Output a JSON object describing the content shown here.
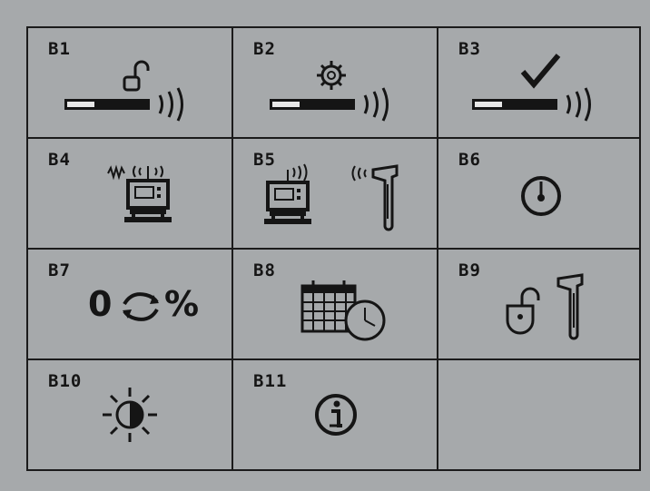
{
  "menu": {
    "cells": [
      {
        "label": "B1",
        "icon": "unlock-signal-strength-icon"
      },
      {
        "label": "B2",
        "icon": "gear-signal-strength-icon"
      },
      {
        "label": "B3",
        "icon": "check-signal-strength-icon"
      },
      {
        "label": "B4",
        "icon": "transmitter-wireless-icon"
      },
      {
        "label": "B5",
        "icon": "transmitter-receiver-pairing-icon"
      },
      {
        "label": "B6",
        "icon": "dial-gauge-icon"
      },
      {
        "label": "B7",
        "icon": "zero-reset-percent-icon",
        "zero": "0",
        "percent": "%"
      },
      {
        "label": "B8",
        "icon": "calendar-clock-icon"
      },
      {
        "label": "B9",
        "icon": "unlock-locator-icon"
      },
      {
        "label": "B10",
        "icon": "brightness-icon"
      },
      {
        "label": "B11",
        "icon": "info-icon"
      },
      {
        "label": "",
        "icon": ""
      }
    ]
  },
  "colors": {
    "background": "#a6a9ab",
    "ink": "#1b1b1b",
    "bar_light": "#e8e8e8"
  }
}
